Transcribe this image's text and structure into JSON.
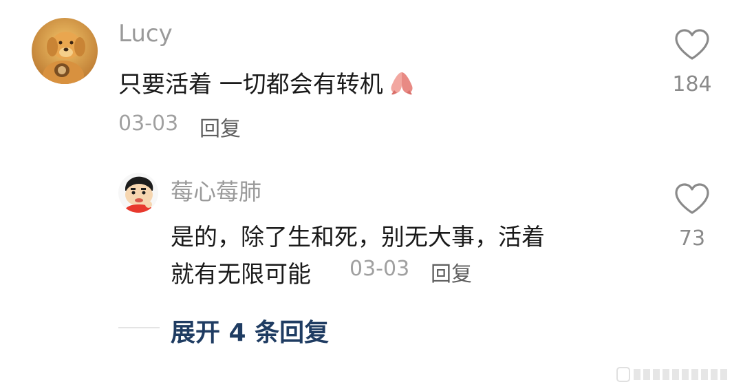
{
  "comments": [
    {
      "username": "Lucy",
      "text": "只要活着 一切都会有转机",
      "emoji_icon": "praying-hands-icon",
      "date": "03-03",
      "reply_label": "回复",
      "likes": "184",
      "avatar_icon": "golden-retriever-avatar"
    }
  ],
  "replies": [
    {
      "username": "莓心莓肺",
      "text_line1": "是的，除了生和死，别无大事，活着",
      "text_line2": "就有无限可能",
      "date": "03-03",
      "reply_label": "回复",
      "likes": "73",
      "avatar_icon": "cartoon-boy-avatar"
    }
  ],
  "expand_replies_label": "展开 4 条回复",
  "colors": {
    "username": "#9a9a9a",
    "meta": "#a0a0a0",
    "expand_link": "#1f3c62",
    "heart_outline": "#8a8a8a"
  }
}
